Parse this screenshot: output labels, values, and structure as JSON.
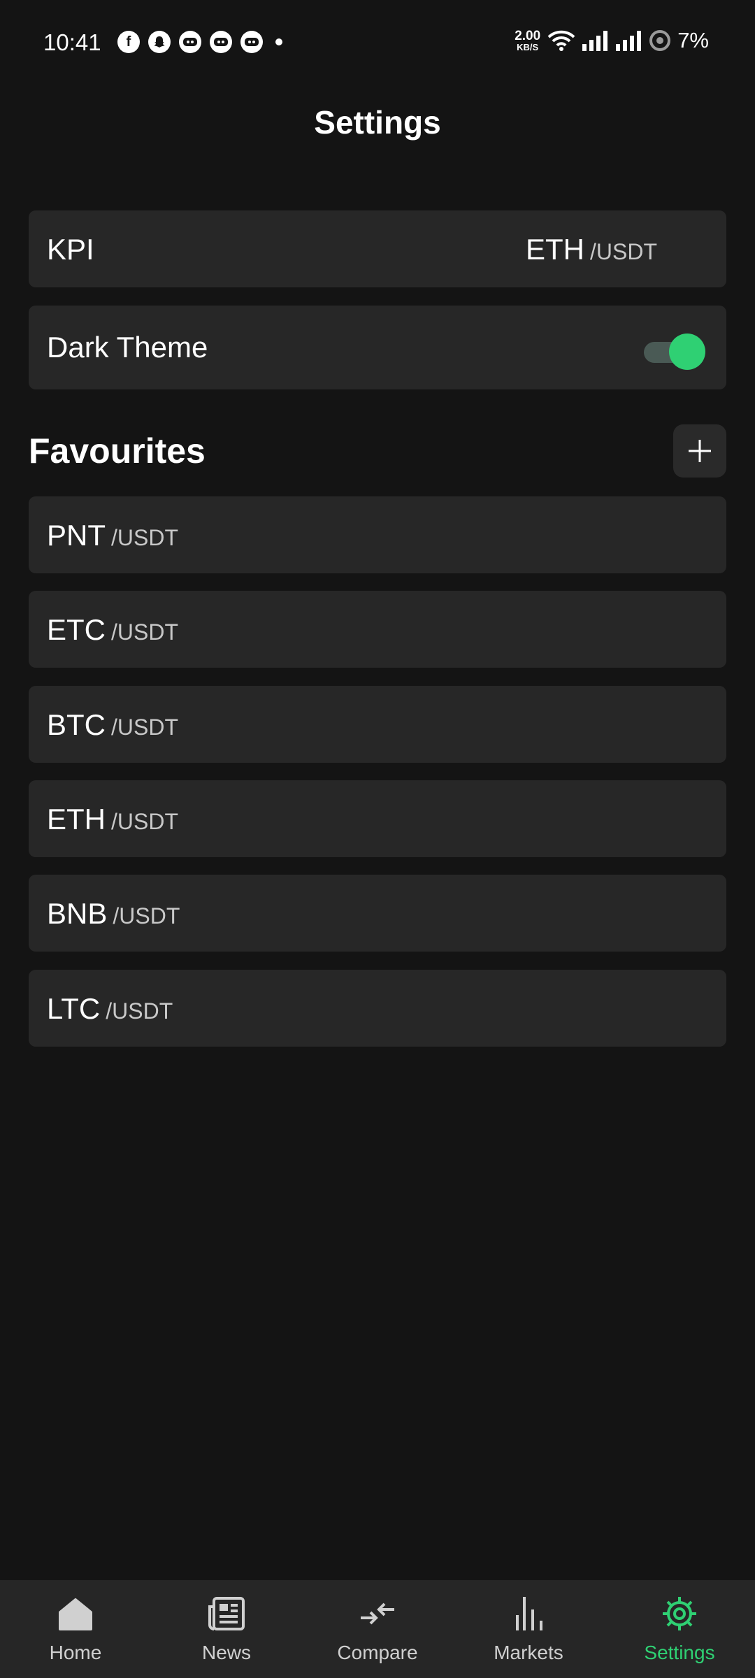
{
  "status_bar": {
    "time": "10:41",
    "app_icons": [
      "facebook-icon",
      "snapchat-icon",
      "discord-icon",
      "discord-icon",
      "discord-icon"
    ],
    "net_speed_value": "2.00",
    "net_speed_unit": "KB/S",
    "battery": "7%"
  },
  "header": {
    "title": "Settings"
  },
  "kpi": {
    "label": "KPI",
    "base": "ETH",
    "quote": "/USDT"
  },
  "theme": {
    "label": "Dark Theme",
    "enabled": true,
    "accent_color": "#2fd073"
  },
  "favourites": {
    "title": "Favourites",
    "items": [
      {
        "base": "PNT",
        "quote": "/USDT"
      },
      {
        "base": "ETC",
        "quote": "/USDT"
      },
      {
        "base": "BTC",
        "quote": "/USDT"
      },
      {
        "base": "ETH",
        "quote": "/USDT"
      },
      {
        "base": "BNB",
        "quote": "/USDT"
      },
      {
        "base": "LTC",
        "quote": "/USDT"
      }
    ]
  },
  "nav": {
    "items": [
      {
        "label": "Home",
        "icon": "home-icon"
      },
      {
        "label": "News",
        "icon": "news-icon"
      },
      {
        "label": "Compare",
        "icon": "compare-icon"
      },
      {
        "label": "Markets",
        "icon": "markets-icon"
      },
      {
        "label": "Settings",
        "icon": "gear-icon"
      }
    ],
    "active": "Settings"
  }
}
